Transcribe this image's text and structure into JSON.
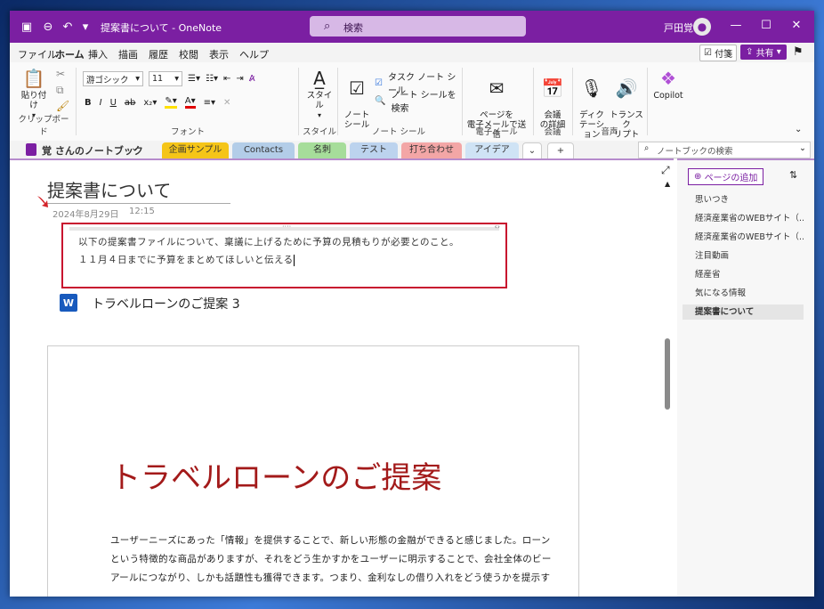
{
  "titlebar": {
    "title": "提案書について - OneNote",
    "search_label": "検索",
    "user": "戸田覚"
  },
  "menu": {
    "items": [
      "ファイル",
      "ホーム",
      "挿入",
      "描画",
      "履歴",
      "校閲",
      "表示",
      "ヘルプ"
    ],
    "active": "ホーム",
    "tag_label": "付箋",
    "share_label": "共有"
  },
  "ribbon": {
    "paste": "貼り付け",
    "clipboard": "クリップボード",
    "font_name": "游ゴシック",
    "font_size": "11",
    "font_group": "フォント",
    "style_btn": "スタイル",
    "style_group": "スタイル",
    "note_tag_btn": "ノート\nシール",
    "task_tag": "タスク ノート シール",
    "find_tags": "ノート シールを検索",
    "tags_group": "ノート シール",
    "email_btn": "ページを\n電子メールで送信",
    "email_group": "電子メール",
    "meeting_btn": "会議\nの詳細",
    "meeting_group": "会議",
    "dictate_btn": "ディク\nテーション",
    "transcribe_btn": "トランスク\nリプト",
    "voice_group": "音声",
    "copilot_btn": "Copilot"
  },
  "notebook": {
    "name": "覚 さんのノートブック",
    "tabs": [
      "企画サンプル",
      "Contacts",
      "名刺",
      "テスト",
      "打ち合わせ",
      "アイデア"
    ],
    "tab_colors": [
      "#f5c518",
      "#b3cde8",
      "#a6dd9a",
      "#bcd3ee",
      "#f3a6a6",
      "#cfe3f5"
    ],
    "search_placeholder": "ノートブックの検索"
  },
  "page": {
    "title": "提案書について",
    "date": "2024年8月29日",
    "time": "12:15",
    "note_line1": "以下の提案書ファイルについて、稟議に上げるために予算の見積もりが必要とのこと。",
    "note_line2": "１１月４日までに予算をまとめてほしいと伝える",
    "file_title": "トラベルローンのご提案 3",
    "doc_heading": "トラベルローンのご提案",
    "doc_para1": "ユーザーニーズにあった「情報」を提供することで、新しい形態の金融ができると感じました。ローン",
    "doc_para2": "という特徴的な商品がありますが、それをどう生かすかをユーザーに明示することで、会社全体のビー",
    "doc_para3": "アールにつながり、しかも話題性も獲得できます。つまり、金利なしの借り入れをどう使うかを提示す"
  },
  "pages_panel": {
    "add_label": "ページの追加",
    "items": [
      "思いつき",
      "経済産業省のWEBサイト（…",
      "経済産業省のWEBサイト（…",
      "注目動画",
      "経産省",
      "気になる情報",
      "提案書について"
    ],
    "active_index": 6
  }
}
